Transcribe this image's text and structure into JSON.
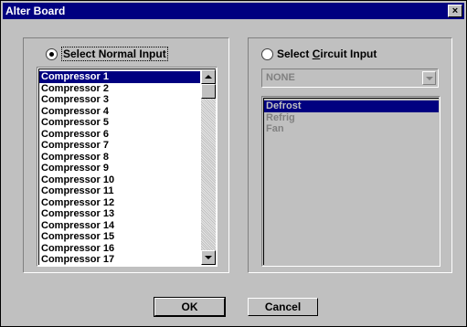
{
  "window": {
    "title": "Alter Board",
    "close_label": "×"
  },
  "normal_input": {
    "radio_label": "Select Normal Input",
    "radio_checked": true,
    "items": [
      "Compressor 1",
      "Compressor 2",
      "Compressor 3",
      "Compressor 4",
      "Compressor 5",
      "Compressor 6",
      "Compressor 7",
      "Compressor 8",
      "Compressor 9",
      "Compressor 10",
      "Compressor 11",
      "Compressor 12",
      "Compressor 13",
      "Compressor 14",
      "Compressor 15",
      "Compressor 16",
      "Compressor 17"
    ],
    "selected_index": 0
  },
  "circuit_input": {
    "radio_label": "Select Circuit Input",
    "radio_checked": false,
    "combo_value": "NONE",
    "items": [
      "Defrost",
      "Refrig",
      "Fan"
    ],
    "selected_index": 0
  },
  "buttons": {
    "ok_label": "OK",
    "cancel_label": "Cancel"
  },
  "colors": {
    "title_bar": "#000080",
    "face": "#c0c0c0",
    "selection": "#000080"
  }
}
